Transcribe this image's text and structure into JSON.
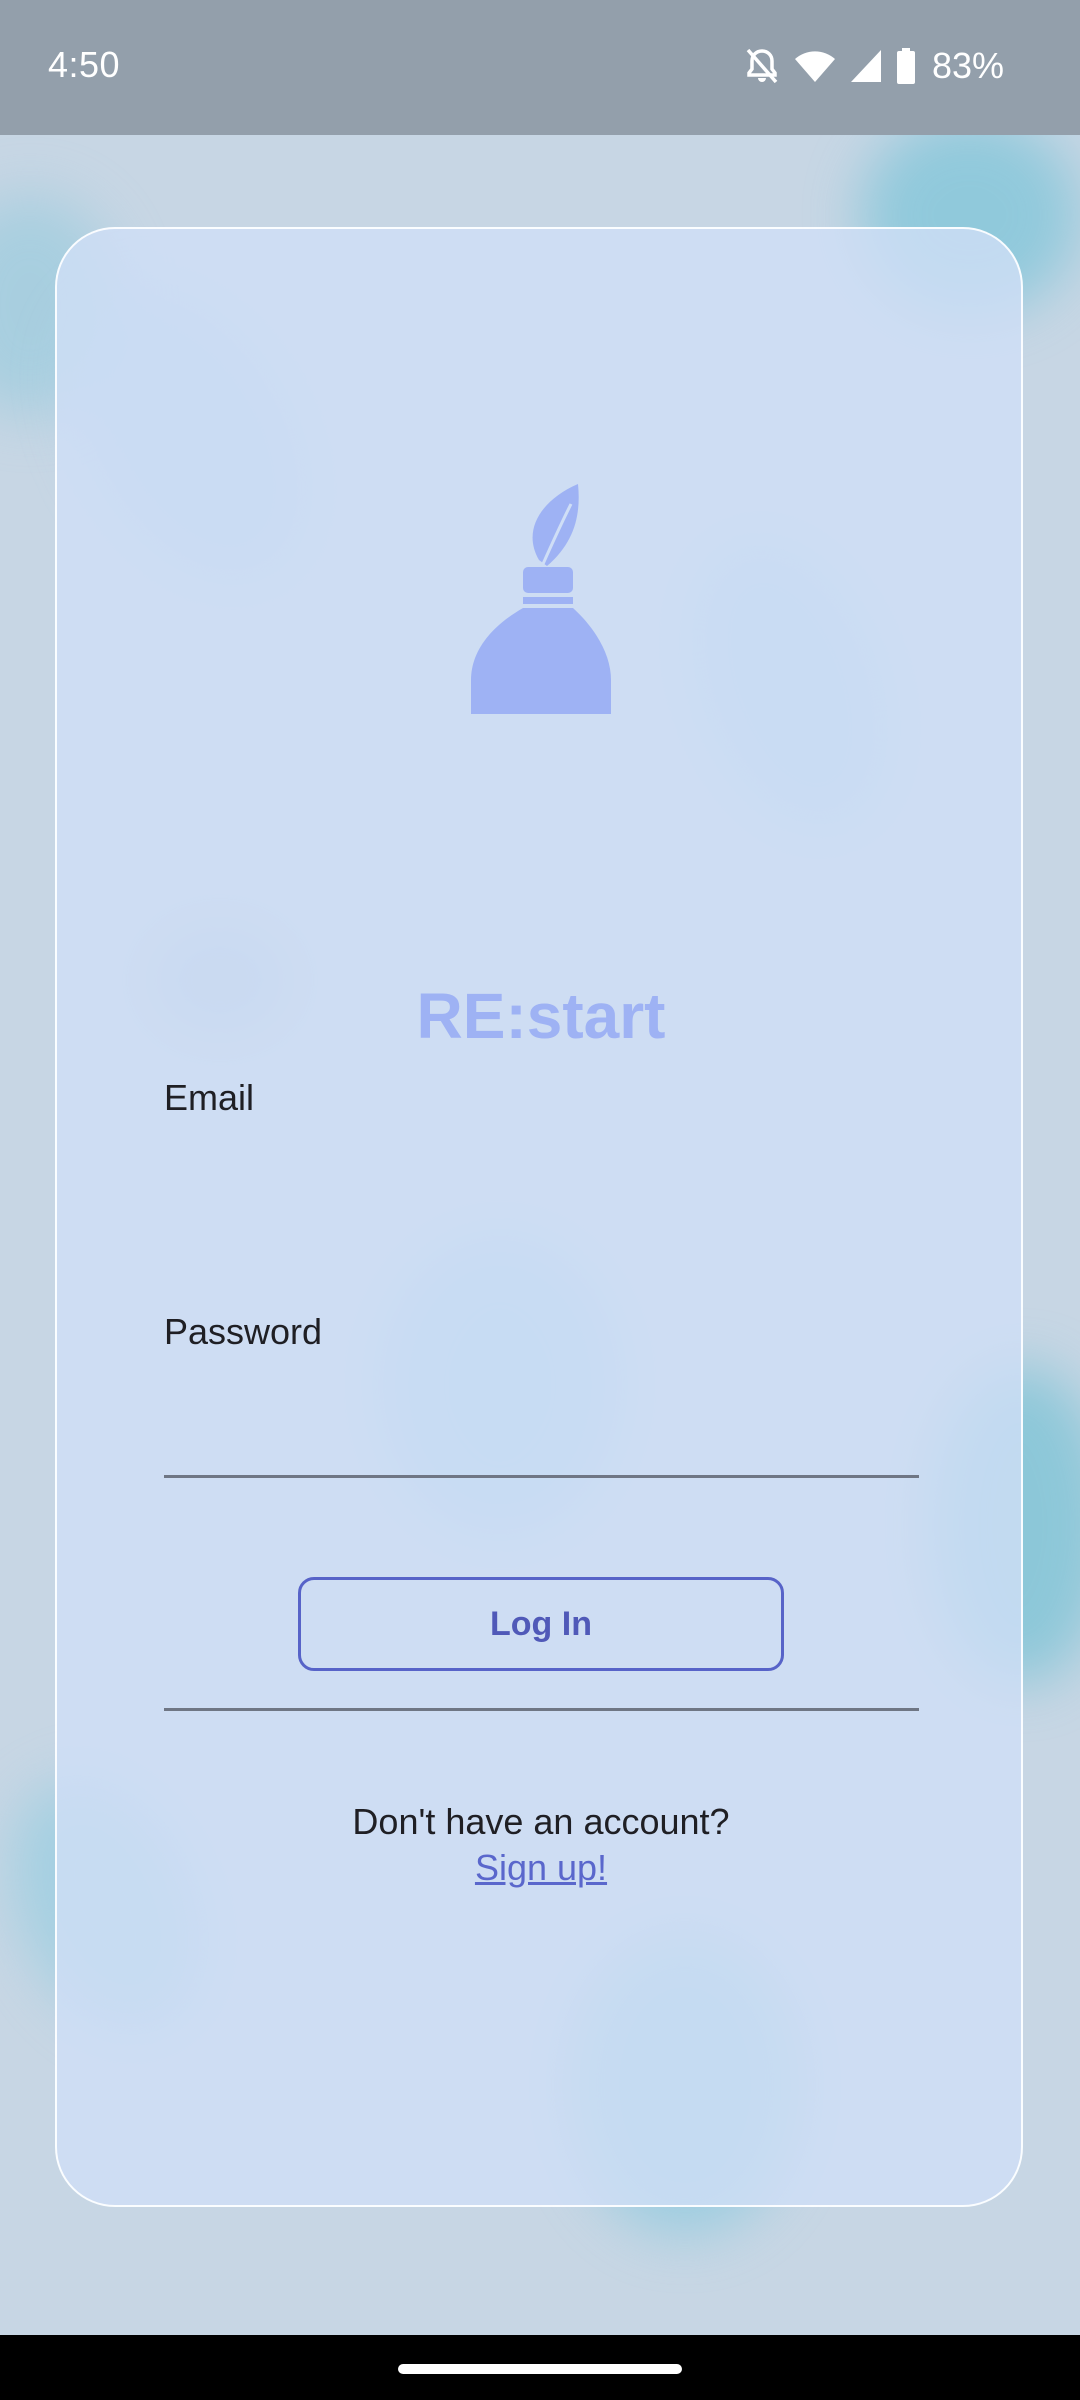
{
  "status_bar": {
    "time": "4:50",
    "battery_percent": "83%",
    "icons": [
      "mute-icon",
      "wifi-icon",
      "signal-icon",
      "battery-icon"
    ]
  },
  "app": {
    "name": "RE:start",
    "logo_icon": "bottle-leaf-icon",
    "accent_color": "#9eb2f4",
    "button_color": "#5763c8"
  },
  "login_form": {
    "email_label": "Email",
    "email_value": "",
    "password_label": "Password",
    "password_value": "",
    "login_button_label": "Log In"
  },
  "signup": {
    "prompt": "Don't have an account?",
    "link_label": "Sign up!"
  }
}
